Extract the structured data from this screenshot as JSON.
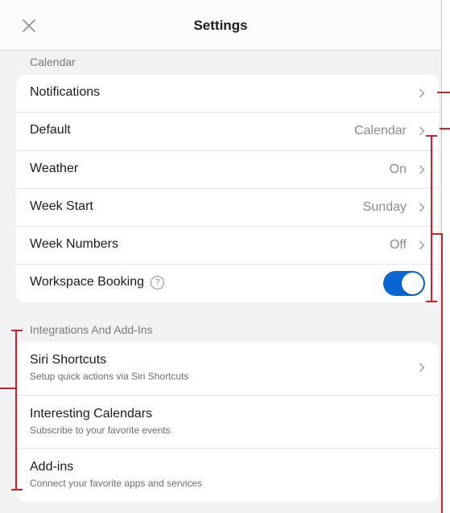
{
  "header": {
    "title": "Settings"
  },
  "calendar_section": {
    "title": "Calendar",
    "rows": [
      {
        "label": "Notifications",
        "value": ""
      },
      {
        "label": "Default",
        "value": "Calendar"
      },
      {
        "label": "Weather",
        "value": "On"
      },
      {
        "label": "Week Start",
        "value": "Sunday"
      },
      {
        "label": "Week Numbers",
        "value": "Off"
      },
      {
        "label": "Workspace Booking",
        "toggle": true
      }
    ]
  },
  "integrations_section": {
    "title": "Integrations And Add-Ins",
    "rows": [
      {
        "label": "Siri Shortcuts",
        "subtitle": "Setup quick actions via Siri Shortcuts"
      },
      {
        "label": "Interesting Calendars",
        "subtitle": "Subscribe to your favorite events"
      },
      {
        "label": "Add-ins",
        "subtitle": "Connect your favorite apps and services"
      }
    ]
  },
  "colors": {
    "toggle_on": "#0a66d1",
    "annotation": "#c8232c"
  },
  "icons": [
    "close-icon",
    "chevron-right-icon",
    "help-circle-icon"
  ]
}
